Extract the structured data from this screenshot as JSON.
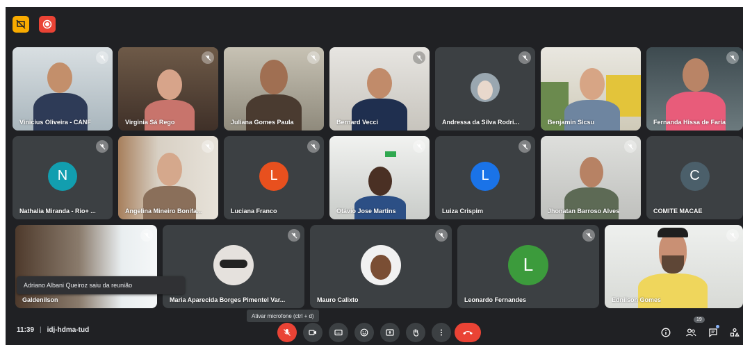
{
  "meeting": {
    "time": "11:39",
    "separator": "|",
    "code": "idj-hdma-tud"
  },
  "participants_count": "19",
  "toast": "Adriano Albani Queiroz saiu da reunião",
  "tooltip": "Ativar microfone (ctrl + d)",
  "tiles": [
    {
      "name": "Vinicius Oliveira - CANF"
    },
    {
      "name": "Virginia Sá Rego"
    },
    {
      "name": "Juliana Gomes Paula"
    },
    {
      "name": "Bernard Vecci"
    },
    {
      "name": "Andressa da Silva Rodri..."
    },
    {
      "name": "Benjamin Sicsu"
    },
    {
      "name": "Fernanda Hissa de Faria"
    },
    {
      "name": "Nathalia Miranda - Rio+ ...",
      "initial": "N",
      "color": "#129eaf"
    },
    {
      "name": "Angelina Mineiro Bonifa..."
    },
    {
      "name": "Luciana Franco",
      "initial": "L",
      "color": "#e8501e"
    },
    {
      "name": "Otávio Jose Martins"
    },
    {
      "name": "Luiza Crispim",
      "initial": "L",
      "color": "#1a73e8"
    },
    {
      "name": "Jhonatan Barroso Alves"
    },
    {
      "name": "COMITE MACAE",
      "initial": "C",
      "color": "#4b5f6a"
    },
    {
      "name": "Galdenilson"
    },
    {
      "name": "Maria Aparecida Borges Pimentel Var..."
    },
    {
      "name": "Mauro Calixto"
    },
    {
      "name": "Leonardo Fernandes",
      "initial": "L",
      "color": "#3c9b3c"
    },
    {
      "name": "Ednilson Gomes"
    }
  ],
  "colors": {
    "background": "#202124",
    "danger": "#ea4335",
    "warning": "#f9ab00"
  }
}
